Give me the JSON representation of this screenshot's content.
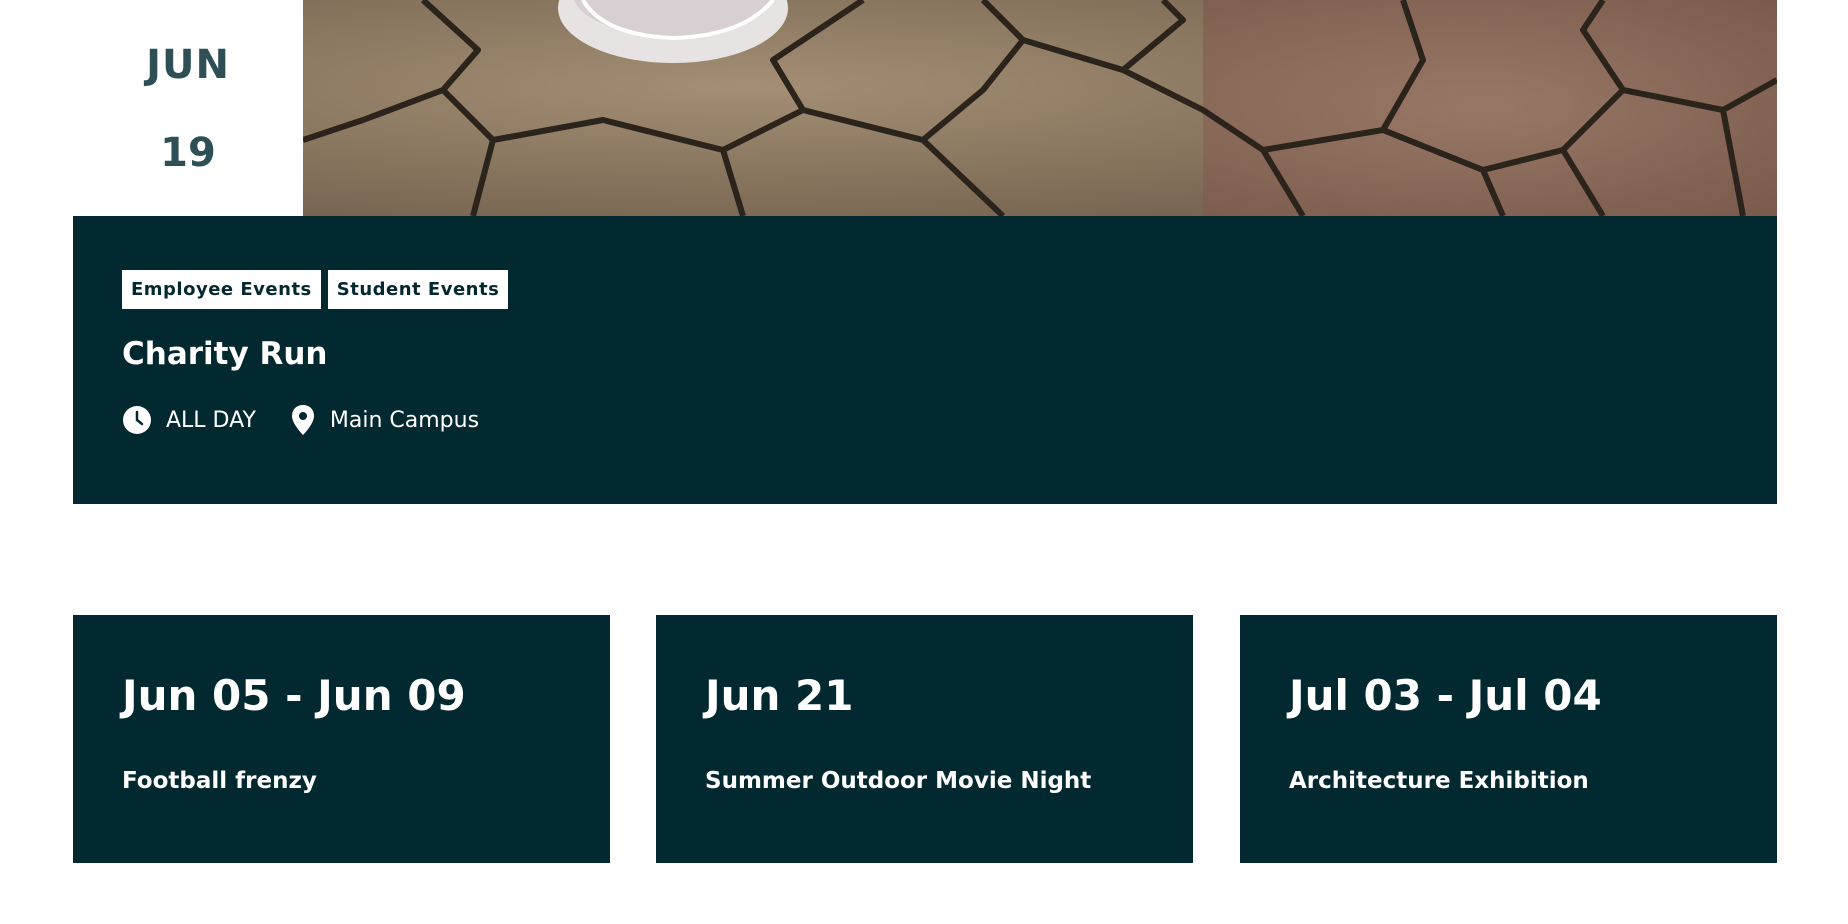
{
  "featured_event": {
    "month": "JUN",
    "day": "19",
    "tags": [
      "Employee Events",
      "Student Events"
    ],
    "title": "Charity Run",
    "time": "ALL DAY",
    "location": "Main Campus",
    "time_icon": "clock-icon",
    "location_icon": "map-pin-icon"
  },
  "events": [
    {
      "date": "Jun 05 - Jun 09",
      "title": "Football frenzy"
    },
    {
      "date": "Jun 21",
      "title": "Summer Outdoor Movie Night"
    },
    {
      "date": "Jul 03 - Jul 04",
      "title": "Architecture Exhibition"
    }
  ],
  "colors": {
    "panel_bg": "#022830",
    "date_text": "#2f4f57",
    "tag_bg": "#ffffff"
  }
}
